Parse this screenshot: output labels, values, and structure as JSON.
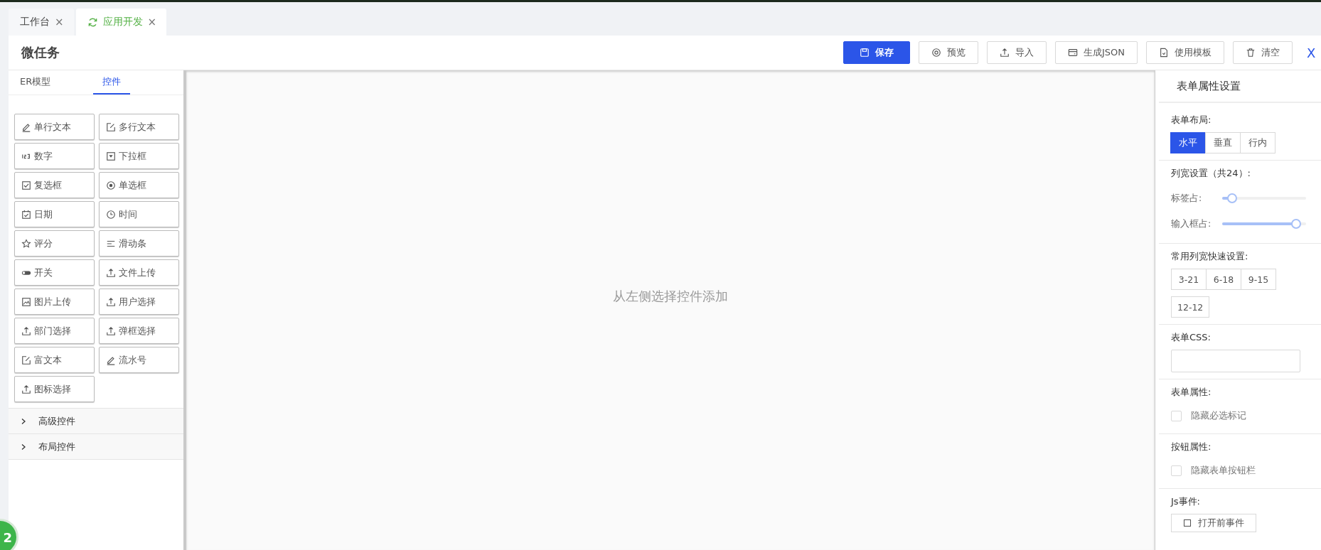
{
  "tabs": [
    {
      "label": "工作台",
      "selected": false,
      "loading": false,
      "close": "×"
    },
    {
      "label": "应用开发",
      "selected": true,
      "loading": true,
      "close": "×"
    }
  ],
  "page_title": "微任务",
  "toolbar": [
    {
      "label": "保存",
      "kind": "save",
      "primary": true
    },
    {
      "label": "预览",
      "kind": "eye",
      "primary": false
    },
    {
      "label": "导入",
      "kind": "upload",
      "primary": false
    },
    {
      "label": "生成JSON",
      "kind": "card",
      "primary": false
    },
    {
      "label": "使用模板",
      "kind": "file",
      "primary": false
    },
    {
      "label": "清空",
      "kind": "trash",
      "primary": false
    }
  ],
  "close_label": "X",
  "left_tabs": [
    {
      "label": "ER模型",
      "selected": false
    },
    {
      "label": "控件",
      "selected": true
    }
  ],
  "widgets": [
    {
      "label": "单行文本",
      "kind": "pencil"
    },
    {
      "label": "多行文本",
      "kind": "edit"
    },
    {
      "label": "数字",
      "kind": "number"
    },
    {
      "label": "下拉框",
      "kind": "dropdown"
    },
    {
      "label": "复选框",
      "kind": "checkbox"
    },
    {
      "label": "单选框",
      "kind": "radio"
    },
    {
      "label": "日期",
      "kind": "date"
    },
    {
      "label": "时间",
      "kind": "clock"
    },
    {
      "label": "评分",
      "kind": "star"
    },
    {
      "label": "滑动条",
      "kind": "lines"
    },
    {
      "label": "开关",
      "kind": "switch"
    },
    {
      "label": "文件上传",
      "kind": "upload"
    },
    {
      "label": "图片上传",
      "kind": "image"
    },
    {
      "label": "用户选择",
      "kind": "upload"
    },
    {
      "label": "部门选择",
      "kind": "upload"
    },
    {
      "label": "弹框选择",
      "kind": "upload"
    },
    {
      "label": "富文本",
      "kind": "edit"
    },
    {
      "label": "流水号",
      "kind": "pencil"
    },
    {
      "label": "图标选择",
      "kind": "upload"
    }
  ],
  "groups": [
    {
      "label": "高级控件",
      "expanded": false
    },
    {
      "label": "布局控件",
      "expanded": false
    }
  ],
  "canvas_hint": "从左侧选择控件添加",
  "badge": "2",
  "properties": {
    "title": "表单属性设置",
    "layout_label": "表单布局:",
    "layouts": [
      {
        "label": "水平",
        "selected": true
      },
      {
        "label": "垂直",
        "selected": false
      },
      {
        "label": "行内",
        "selected": false
      }
    ],
    "width_label": "列宽设置（共24）:",
    "sliders": [
      {
        "label": "标签占:",
        "level": 0.12
      },
      {
        "label": "输入框占:",
        "level": 0.88
      }
    ],
    "quick_label": "常用列宽快速设置:",
    "quick": [
      "3-21",
      "6-18",
      "9-15",
      "12-12"
    ],
    "css_label": "表单CSS:",
    "form_attr_label": "表单属性:",
    "form_attr": {
      "label": "隐藏必选标记",
      "checked": false
    },
    "button_attr_label": "按钮属性:",
    "button_attr": {
      "label": "隐藏表单按钮栏",
      "checked": false
    },
    "js_label": "Js事件:",
    "js_button": "打开前事件"
  }
}
